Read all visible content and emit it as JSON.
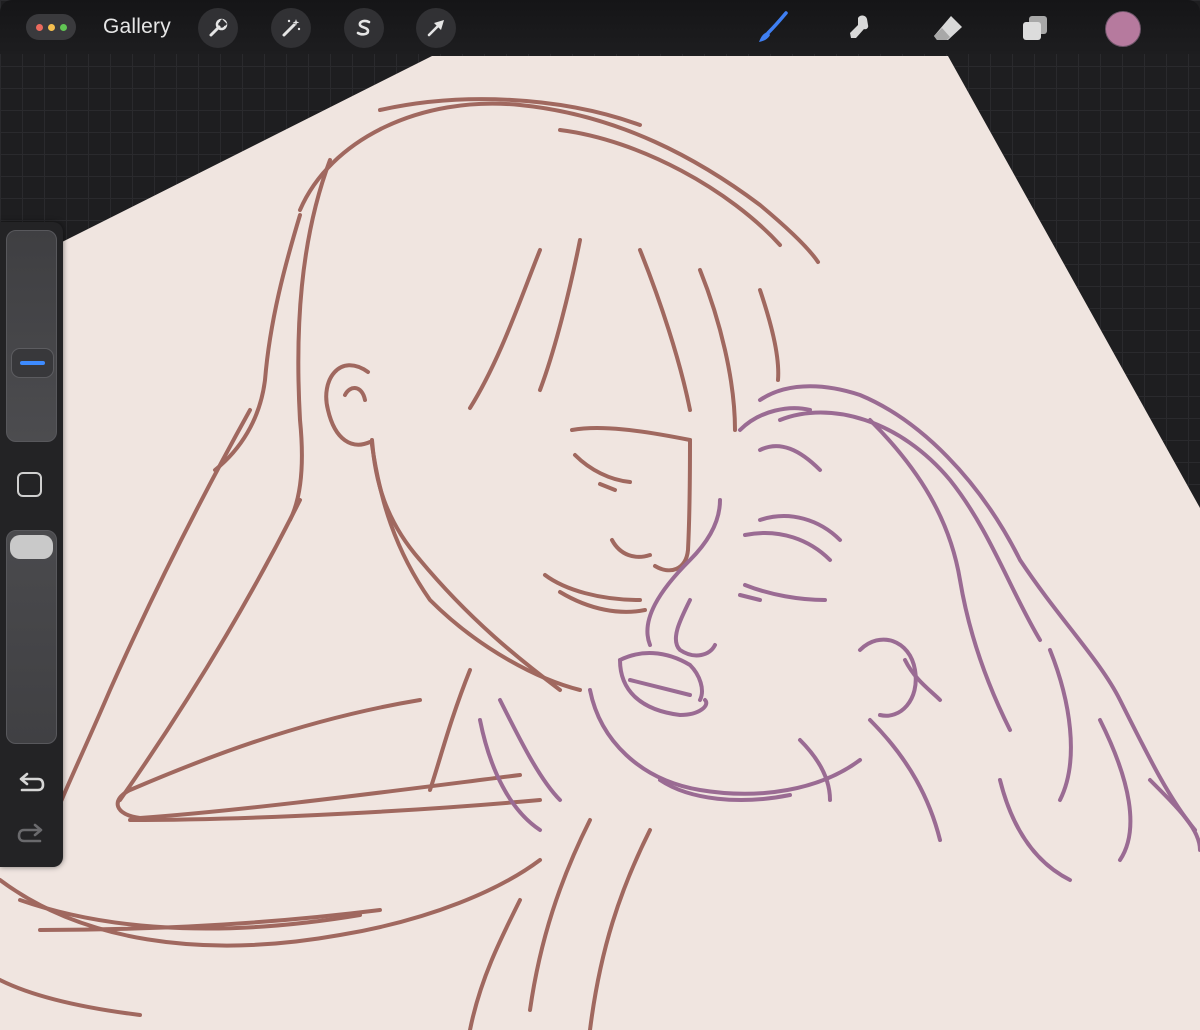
{
  "toolbar": {
    "gallery_label": "Gallery",
    "left_tools": [
      "wrench-icon",
      "magic-wand-icon",
      "selection-s-icon",
      "arrow-transform-icon"
    ],
    "right_tools": [
      "brush-icon",
      "smudge-icon",
      "eraser-icon",
      "layers-icon"
    ],
    "active_tool": "brush-icon",
    "current_color": "#b67a9e"
  },
  "sidebar": {
    "brush_size_slider_value": 0.35,
    "opacity_slider_value": 1.0,
    "controls": [
      "brush-size-slider",
      "modify-button",
      "opacity-slider",
      "undo-button",
      "redo-button"
    ]
  },
  "canvas": {
    "paper_color": "#f0e5e0",
    "line_colors": [
      "#a0685f",
      "#9a6b93"
    ],
    "content": "sketch"
  }
}
